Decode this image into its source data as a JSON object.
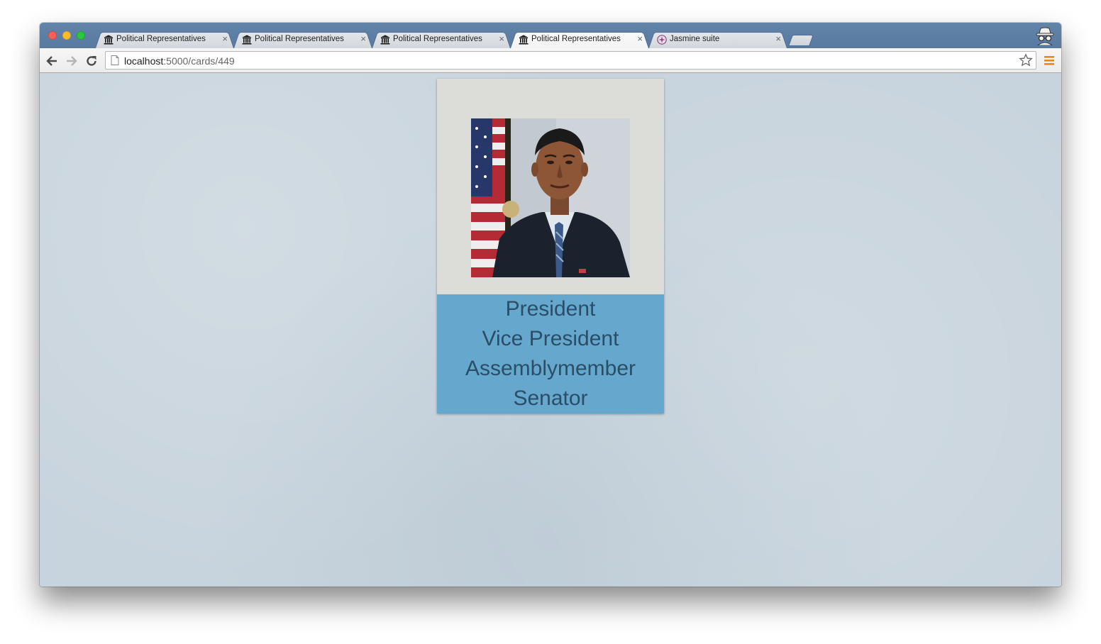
{
  "browser": {
    "tabs": [
      {
        "title": "Political Representatives",
        "icon": "building-columns-icon",
        "active": false
      },
      {
        "title": "Political Representatives",
        "icon": "building-columns-icon",
        "active": false
      },
      {
        "title": "Political Representatives",
        "icon": "building-columns-icon",
        "active": false
      },
      {
        "title": "Political Representatives",
        "icon": "building-columns-icon",
        "active": true
      },
      {
        "title": "Jasmine suite",
        "icon": "jasmine-icon",
        "active": false
      }
    ],
    "tab_close_glyph": "×",
    "url_host": "localhost",
    "url_path": ":5000/cards/449"
  },
  "card": {
    "roles": [
      "President",
      "Vice President",
      "Assemblymember",
      "Senator"
    ],
    "colors": {
      "card_top": "#dcdcd8",
      "card_bottom": "#66a8cd",
      "role_text": "#2a4e68"
    }
  }
}
